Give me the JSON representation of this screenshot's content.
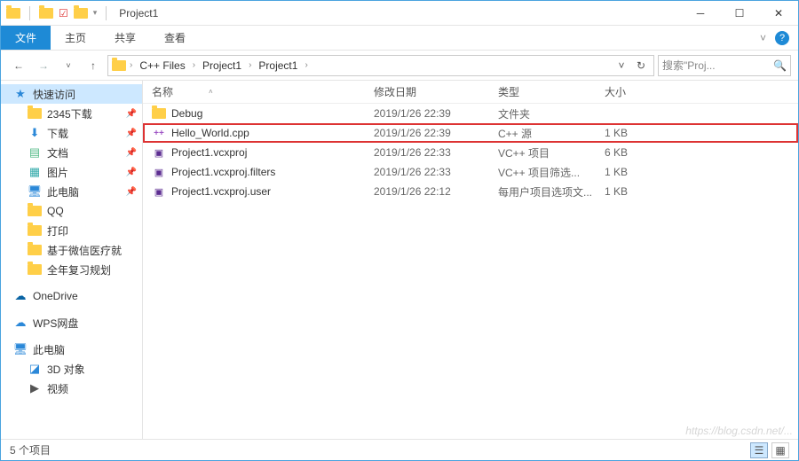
{
  "titlebar": {
    "title": "Project1"
  },
  "ribbon": {
    "tabs": {
      "file": "文件",
      "home": "主页",
      "share": "共享",
      "view": "查看"
    }
  },
  "address": {
    "crumbs": [
      "C++ Files",
      "Project1",
      "Project1"
    ]
  },
  "search": {
    "placeholder": "搜索\"Proj..."
  },
  "nav": {
    "quick_access": "快速访问",
    "items": [
      {
        "label": "2345下载",
        "pinned": true
      },
      {
        "label": "下载",
        "pinned": true
      },
      {
        "label": "文档",
        "pinned": true
      },
      {
        "label": "图片",
        "pinned": true
      },
      {
        "label": "此电脑",
        "pinned": true
      },
      {
        "label": "QQ",
        "pinned": false
      },
      {
        "label": "打印",
        "pinned": false
      },
      {
        "label": "基于微信医疗就",
        "pinned": false
      },
      {
        "label": "全年复习规划",
        "pinned": false
      }
    ],
    "onedrive": "OneDrive",
    "wps": "WPS网盘",
    "thispc": "此电脑",
    "threed": "3D 对象",
    "video": "视频"
  },
  "columns": {
    "name": "名称",
    "date": "修改日期",
    "type": "类型",
    "size": "大小"
  },
  "files": [
    {
      "name": "Debug",
      "date": "2019/1/26 22:39",
      "type": "文件夹",
      "size": "",
      "icon": "folder",
      "highlight": false
    },
    {
      "name": "Hello_World.cpp",
      "date": "2019/1/26 22:39",
      "type": "C++ 源",
      "size": "1 KB",
      "icon": "cpp",
      "highlight": true
    },
    {
      "name": "Project1.vcxproj",
      "date": "2019/1/26 22:33",
      "type": "VC++ 项目",
      "size": "6 KB",
      "icon": "vcproj",
      "highlight": false
    },
    {
      "name": "Project1.vcxproj.filters",
      "date": "2019/1/26 22:33",
      "type": "VC++ 项目筛选...",
      "size": "1 KB",
      "icon": "vcproj",
      "highlight": false
    },
    {
      "name": "Project1.vcxproj.user",
      "date": "2019/1/26 22:12",
      "type": "每用户项目选项文...",
      "size": "1 KB",
      "icon": "vcproj",
      "highlight": false
    }
  ],
  "status": {
    "count": "5 个项目"
  },
  "watermark": "https://blog.csdn.net/..."
}
